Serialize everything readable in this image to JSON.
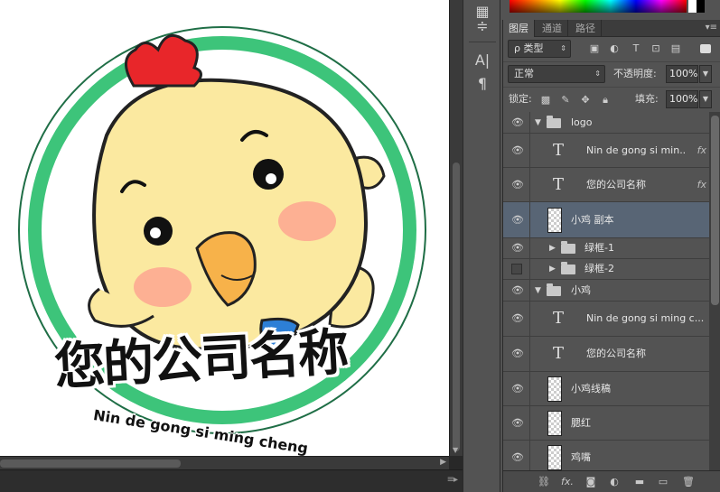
{
  "document": {
    "title_text": "您的公司名称",
    "subtitle_text": "Nin de gong si ming cheng"
  },
  "colors": {
    "ring_green": "#3dc47a",
    "chick_yellow": "#fbe9a0",
    "panel_bg": "#535353",
    "selected_row": "#586575"
  },
  "tools_strip": {
    "items": [
      "layers-tool-icon",
      "adjust-tool-icon",
      "character-icon",
      "paragraph-icon"
    ]
  },
  "layers_panel": {
    "tabs": [
      "图层",
      "通道",
      "路径"
    ],
    "active_tab": "图层",
    "filter_label": "ρ 类型",
    "blend_mode": "正常",
    "opacity_label": "不透明度:",
    "opacity_value": "100%",
    "lock_label": "锁定:",
    "fill_label": "填充:",
    "fill_value": "100%",
    "layers": [
      {
        "kind": "group",
        "name": "logo",
        "visible": true,
        "expanded": true,
        "indent": 0
      },
      {
        "kind": "text",
        "name": "Nin de gong si min...",
        "visible": true,
        "fx": "fx",
        "indent": 1
      },
      {
        "kind": "text",
        "name": "您的公司名称",
        "visible": true,
        "fx": "fx",
        "indent": 1
      },
      {
        "kind": "pixel",
        "name": "小鸡 副本",
        "visible": true,
        "selected": true,
        "indent": 1
      },
      {
        "kind": "group",
        "name": "绿框-1",
        "visible": true,
        "expanded": false,
        "indent": 1
      },
      {
        "kind": "group",
        "name": "绿框-2",
        "visible": false,
        "expanded": false,
        "indent": 1
      },
      {
        "kind": "group",
        "name": "小鸡",
        "visible": true,
        "expanded": true,
        "indent": 0
      },
      {
        "kind": "text",
        "name": "Nin de gong si ming c...",
        "visible": true,
        "indent": 1
      },
      {
        "kind": "text",
        "name": "您的公司名称",
        "visible": true,
        "indent": 1
      },
      {
        "kind": "pixel",
        "name": "小鸡线稿",
        "visible": true,
        "indent": 1
      },
      {
        "kind": "pixel",
        "name": "腮红",
        "visible": true,
        "indent": 1
      },
      {
        "kind": "pixel",
        "name": "鸡嘴",
        "visible": true,
        "indent": 1
      }
    ],
    "footer_buttons": [
      "link-layers-icon",
      "fx-icon",
      "add-mask-icon",
      "adjustment-layer-icon",
      "new-group-icon",
      "new-layer-icon",
      "delete-layer-icon"
    ]
  }
}
